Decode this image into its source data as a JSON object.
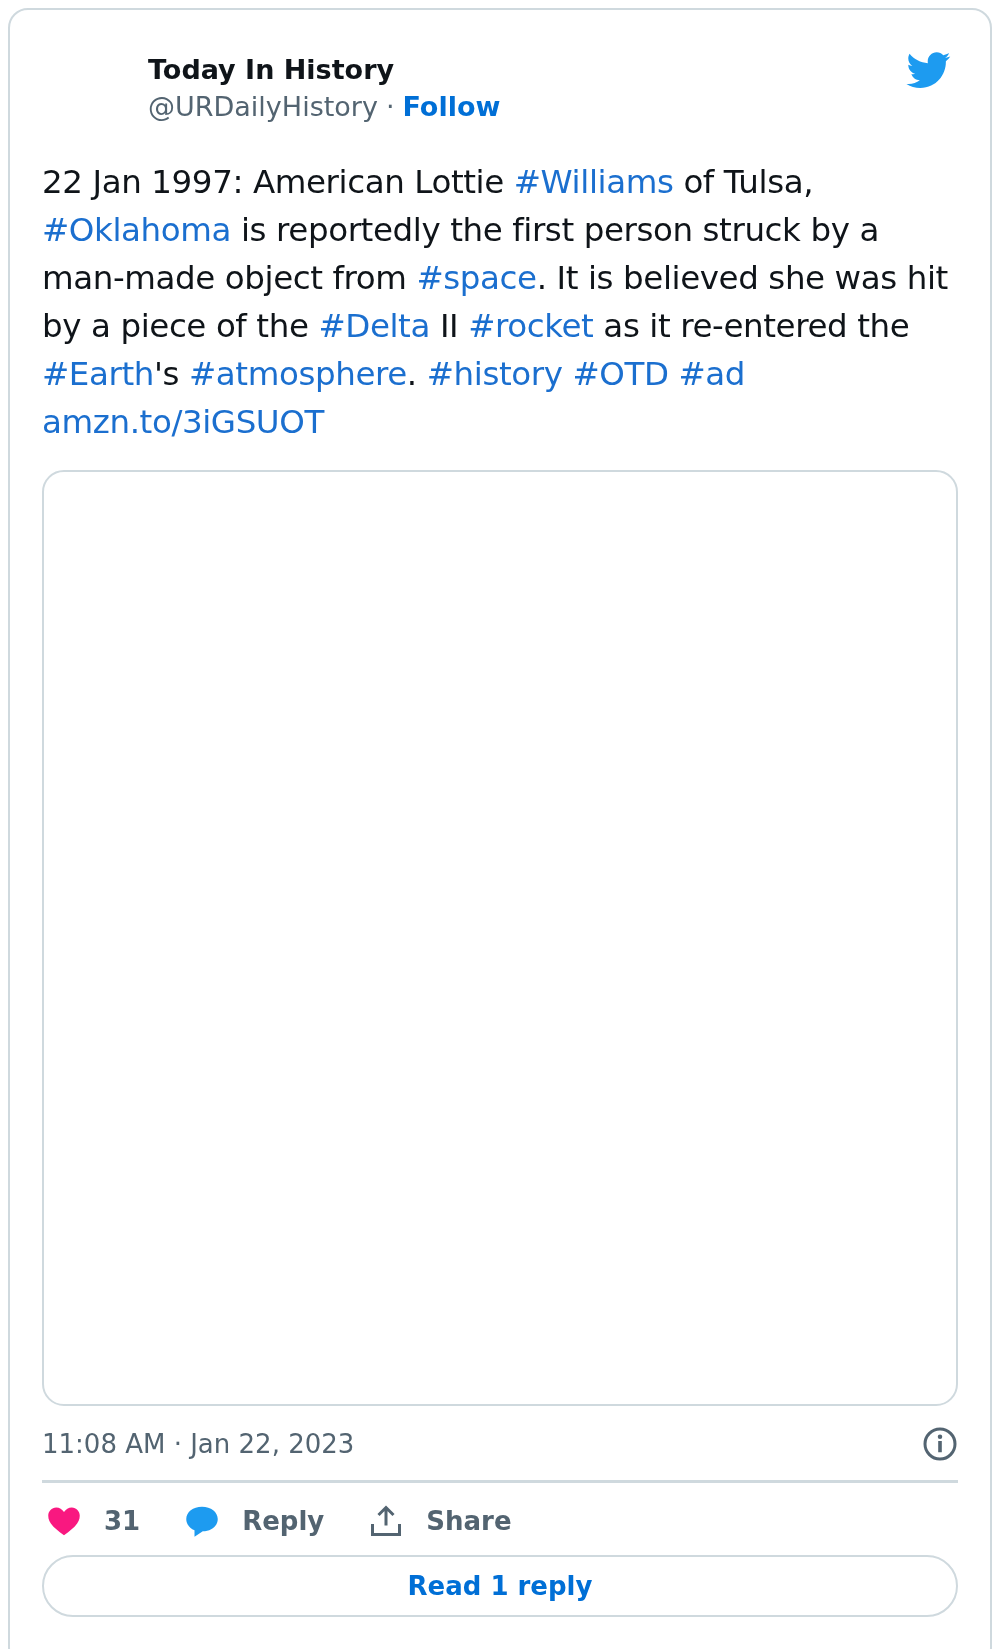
{
  "author": {
    "name": "Today In History",
    "handle": "@URDailyHistory",
    "separator": "·",
    "follow": "Follow"
  },
  "body": [
    {
      "kind": "text",
      "text": "22 Jan 1997: American Lottie "
    },
    {
      "kind": "link",
      "text": "#Williams"
    },
    {
      "kind": "text",
      "text": " of Tulsa, "
    },
    {
      "kind": "link",
      "text": "#Oklahoma"
    },
    {
      "kind": "text",
      "text": " is reportedly the first person struck by a man-made object from "
    },
    {
      "kind": "link",
      "text": "#space"
    },
    {
      "kind": "text",
      "text": ". It is believed she was hit by a piece of the "
    },
    {
      "kind": "link",
      "text": "#Delta"
    },
    {
      "kind": "text",
      "text": " II "
    },
    {
      "kind": "link",
      "text": "#rocket"
    },
    {
      "kind": "text",
      "text": " as it re-entered the "
    },
    {
      "kind": "link",
      "text": "#Earth"
    },
    {
      "kind": "text",
      "text": "'s "
    },
    {
      "kind": "link",
      "text": "#atmosphere"
    },
    {
      "kind": "text",
      "text": ". "
    },
    {
      "kind": "link",
      "text": "#history",
      "space_after": true
    },
    {
      "kind": "link",
      "text": "#OTD",
      "space_after": true
    },
    {
      "kind": "link",
      "text": "#ad",
      "space_after": true
    },
    {
      "kind": "link",
      "text": "amzn.to/3iGSUOT"
    }
  ],
  "timestamp": "11:08 AM · Jan 22, 2023",
  "actions": [
    {
      "kind": "like",
      "label": "31"
    },
    {
      "kind": "reply",
      "label": "Reply"
    },
    {
      "kind": "share",
      "label": "Share"
    }
  ],
  "read_replies": "Read 1 reply"
}
